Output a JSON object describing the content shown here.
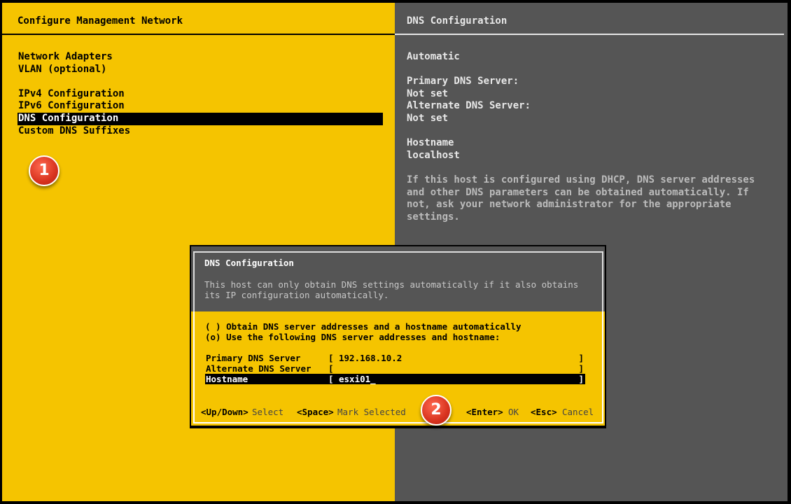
{
  "left_panel": {
    "title": "Configure Management Network",
    "menu": [
      "Network Adapters",
      "VLAN (optional)",
      "IPv4 Configuration",
      "IPv6 Configuration",
      "DNS Configuration",
      "Custom DNS Suffixes"
    ],
    "selected_index": 4
  },
  "right_panel": {
    "title": "DNS Configuration",
    "mode": "Automatic",
    "primary_label": "Primary DNS Server:",
    "primary_value": "Not set",
    "alternate_label": "Alternate DNS Server:",
    "alternate_value": "Not set",
    "hostname_label": "Hostname",
    "hostname_value": "localhost",
    "help": [
      "If this host is configured using DHCP, DNS server addresses",
      "and other DNS parameters can be obtained automatically. If",
      "not, ask your network administrator for the appropriate",
      "settings."
    ]
  },
  "badges": [
    "1",
    "2"
  ],
  "dialog": {
    "title": "DNS Configuration",
    "description": [
      "This host can only obtain DNS settings automatically if it also obtains",
      "its IP configuration automatically."
    ],
    "options": [
      "( ) Obtain DNS server addresses and a hostname automatically",
      "(o) Use the following DNS server addresses and hostname:"
    ],
    "fields": [
      {
        "label": "Primary DNS Server",
        "value": "192.168.10.2"
      },
      {
        "label": "Alternate DNS Server",
        "value": ""
      },
      {
        "label": "Hostname",
        "value": "esxi01_"
      }
    ],
    "bracket_open": "[",
    "bracket_close": "]",
    "keys": [
      {
        "key": "<Up/Down>",
        "action": "Select"
      },
      {
        "key": "<Space>",
        "action": "Mark Selected"
      },
      {
        "key": "<Enter>",
        "action": "OK"
      },
      {
        "key": "<Esc>",
        "action": "Cancel"
      }
    ]
  },
  "colors": {
    "yellow": "#f5c400",
    "gray": "#555555",
    "badge": "#d8331f"
  }
}
